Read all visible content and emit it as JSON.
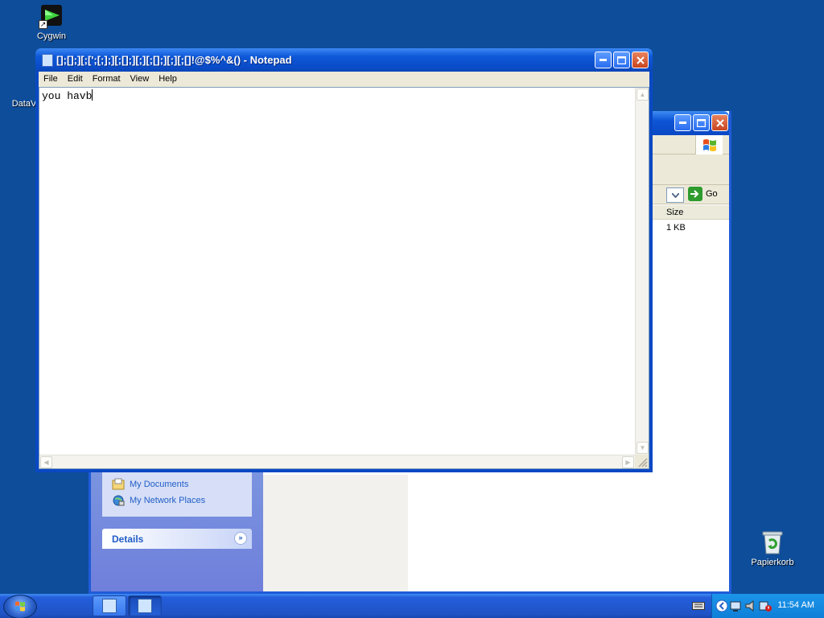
{
  "desktop": {
    "icons": [
      {
        "label": "Cygwin"
      },
      {
        "label": "DataV"
      },
      {
        "label": "Papierkorb"
      }
    ]
  },
  "explorer": {
    "go_label": "Go",
    "column_size": "Size",
    "file_size": "1 KB",
    "side_links": [
      "My Documents",
      "My Network Places"
    ],
    "details_label": "Details"
  },
  "notepad": {
    "title": "[];[];][;[';[;];][;[];][;][;[];][;][;[]!@$%^&()  - Notepad",
    "menu": [
      "File",
      "Edit",
      "Format",
      "View",
      "Help"
    ],
    "content": "you havb"
  },
  "taskbar": {
    "clock": "11:54 AM"
  },
  "colors": {
    "desktop": "#0e4d9a",
    "title_blue": "#0a4cc8",
    "close_red": "#c8451f",
    "menu_bg": "#ece9d8"
  }
}
